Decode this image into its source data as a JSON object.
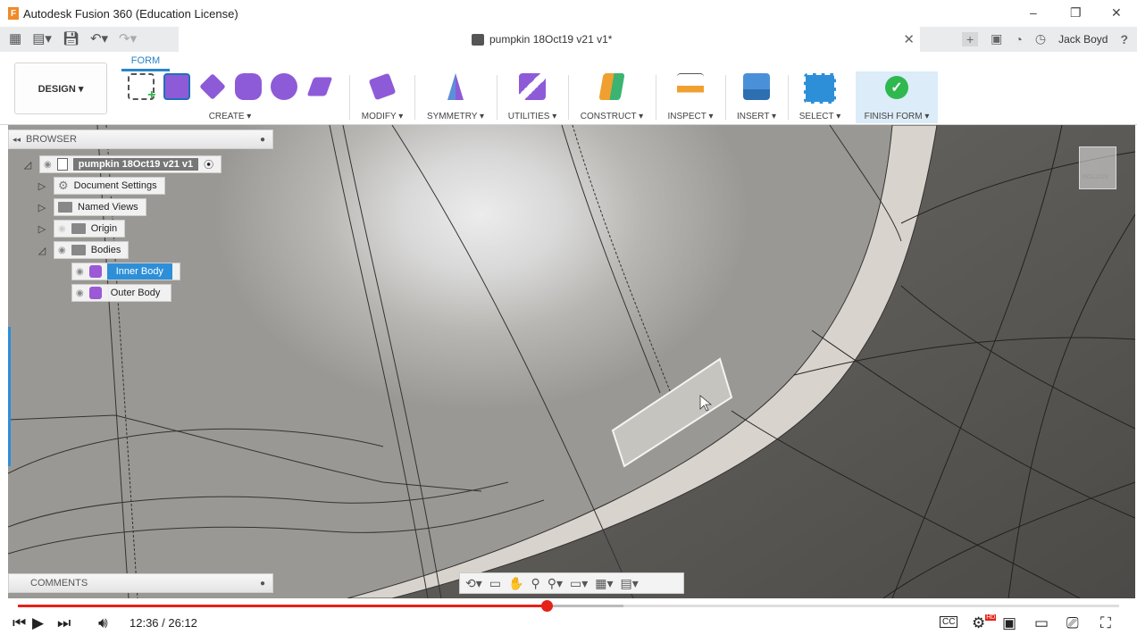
{
  "window": {
    "app_title": "Autodesk Fusion 360 (Education License)",
    "app_icon_letter": "F",
    "minimize": "–",
    "restore": "❐",
    "close": "✕"
  },
  "tabs": {
    "doc_title": "pumpkin 18Oct19 v21 v1*",
    "close": "✕",
    "user": "Jack Boyd",
    "help": "?"
  },
  "toolbar": {
    "workspace": "DESIGN ▾",
    "active_tab": "FORM",
    "groups": {
      "create": "CREATE ▾",
      "modify": "MODIFY ▾",
      "symmetry": "SYMMETRY ▾",
      "utilities": "UTILITIES ▾",
      "construct": "CONSTRUCT ▾",
      "inspect": "INSPECT ▾",
      "insert": "INSERT ▾",
      "select": "SELECT ▾",
      "finish": "FINISH FORM ▾"
    },
    "finish_check": "✓"
  },
  "browser": {
    "title": "BROWSER",
    "collapse": "◂◂",
    "root": "pumpkin 18Oct19 v21 v1",
    "items": [
      {
        "label": "Document Settings"
      },
      {
        "label": "Named Views"
      },
      {
        "label": "Origin"
      },
      {
        "label": "Bodies"
      }
    ],
    "bodies": [
      {
        "label": "Inner Body"
      },
      {
        "label": "Outer Body"
      }
    ]
  },
  "comments": {
    "title": "COMMENTS"
  },
  "viewcube": {
    "face_label": "BOTTOM"
  },
  "player": {
    "time": "12:36 / 26:12",
    "progress": 0.48,
    "buffered": 0.55,
    "cc": "CC",
    "hd": "HD"
  },
  "colors": {
    "accent_blue": "#2d8fd8",
    "progress_red": "#e62117",
    "finish_green": "#2fb84f",
    "form_purple": "#8e5bd8"
  }
}
